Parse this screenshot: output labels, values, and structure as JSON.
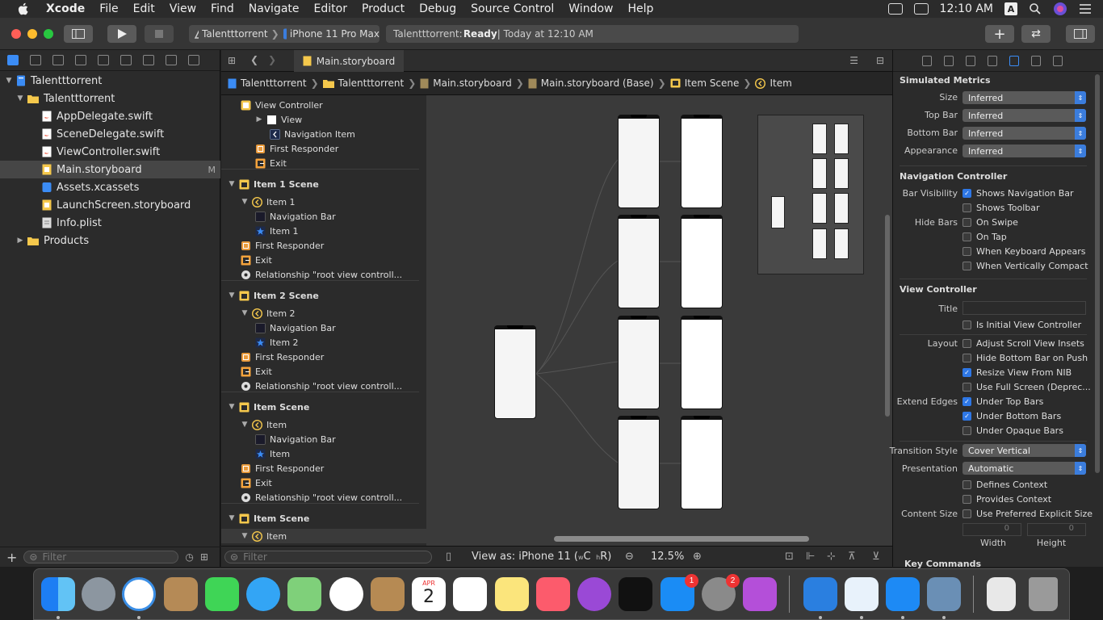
{
  "menubar": {
    "items": [
      "Xcode",
      "File",
      "Edit",
      "View",
      "Find",
      "Navigate",
      "Editor",
      "Product",
      "Debug",
      "Source Control",
      "Window",
      "Help"
    ],
    "clock": "12:10 AM",
    "input_source": "A"
  },
  "toolbar": {
    "scheme": "Talentttorrent",
    "device": "iPhone 11 Pro Max",
    "status_project": "Talentttorrent: ",
    "status_state": "Ready",
    "status_time": " | Today at 12:10 AM"
  },
  "navigator": {
    "items": [
      {
        "label": "Talentttorrent",
        "icon": "project-icon"
      },
      {
        "label": "Talentttorrent",
        "icon": "folder-icon"
      },
      {
        "label": "AppDelegate.swift",
        "icon": "swift-file-icon"
      },
      {
        "label": "SceneDelegate.swift",
        "icon": "swift-file-icon"
      },
      {
        "label": "ViewController.swift",
        "icon": "swift-file-icon"
      },
      {
        "label": "Main.storyboard",
        "icon": "storyboard-file-icon",
        "badge": "M"
      },
      {
        "label": "Assets.xcassets",
        "icon": "assets-icon"
      },
      {
        "label": "LaunchScreen.storyboard",
        "icon": "storyboard-file-icon"
      },
      {
        "label": "Info.plist",
        "icon": "plist-file-icon"
      },
      {
        "label": "Products",
        "icon": "folder-icon"
      }
    ],
    "filter_placeholder": "Filter"
  },
  "editor": {
    "tab": "Main.storyboard",
    "breadcrumb": [
      "Talentttorrent",
      "Talentttorrent",
      "Main.storyboard",
      "Main.storyboard (Base)",
      "Item Scene",
      "Item"
    ]
  },
  "outline": {
    "rows": [
      {
        "label": "View Controller",
        "icon": "view-controller-icon"
      },
      {
        "label": "View",
        "icon": "view-icon"
      },
      {
        "label": "Navigation Item",
        "icon": "navigation-item-icon"
      },
      {
        "label": "First Responder",
        "icon": "first-responder-icon"
      },
      {
        "label": "Exit",
        "icon": "exit-icon"
      },
      {
        "label": "Item 1 Scene",
        "icon": "scene-icon"
      },
      {
        "label": "Item 1",
        "icon": "navigation-controller-icon"
      },
      {
        "label": "Navigation Bar",
        "icon": "navigation-bar-icon"
      },
      {
        "label": "Item 1",
        "icon": "tab-bar-item-icon"
      },
      {
        "label": "First Responder",
        "icon": "first-responder-icon"
      },
      {
        "label": "Exit",
        "icon": "exit-icon"
      },
      {
        "label": "Relationship \"root view controll...",
        "icon": "relationship-icon"
      },
      {
        "label": "Item 2 Scene",
        "icon": "scene-icon"
      },
      {
        "label": "Item 2",
        "icon": "navigation-controller-icon"
      },
      {
        "label": "Navigation Bar",
        "icon": "navigation-bar-icon"
      },
      {
        "label": "Item 2",
        "icon": "tab-bar-item-icon"
      },
      {
        "label": "First Responder",
        "icon": "first-responder-icon"
      },
      {
        "label": "Exit",
        "icon": "exit-icon"
      },
      {
        "label": "Relationship \"root view controll...",
        "icon": "relationship-icon"
      },
      {
        "label": "Item Scene",
        "icon": "scene-icon"
      },
      {
        "label": "Item",
        "icon": "navigation-controller-icon"
      },
      {
        "label": "Navigation Bar",
        "icon": "navigation-bar-icon"
      },
      {
        "label": "Item",
        "icon": "tab-bar-item-icon"
      },
      {
        "label": "First Responder",
        "icon": "first-responder-icon"
      },
      {
        "label": "Exit",
        "icon": "exit-icon"
      },
      {
        "label": "Relationship \"root view controll...",
        "icon": "relationship-icon"
      },
      {
        "label": "Item Scene",
        "icon": "scene-icon"
      },
      {
        "label": "Item",
        "icon": "navigation-controller-icon"
      }
    ],
    "filter_placeholder": "Filter"
  },
  "canvas_bar": {
    "view_as_prefix": "View as: iPhone 11 (",
    "size_w": "w",
    "size_c": "C",
    "size_h": "h",
    "size_r": "R",
    "view_as_suffix": ")",
    "zoom": "12.5%"
  },
  "inspector": {
    "simulated_metrics": "Simulated Metrics",
    "size_label": "Size",
    "size_value": "Inferred",
    "topbar_label": "Top Bar",
    "topbar_value": "Inferred",
    "bottombar_label": "Bottom Bar",
    "bottombar_value": "Inferred",
    "appearance_label": "Appearance",
    "appearance_value": "Inferred",
    "nav_controller": "Navigation Controller",
    "bar_visibility_label": "Bar Visibility",
    "shows_nav_bar": "Shows Navigation Bar",
    "shows_toolbar": "Shows Toolbar",
    "hide_bars_label": "Hide Bars",
    "on_swipe": "On Swipe",
    "on_tap": "On Tap",
    "when_keyboard": "When Keyboard Appears",
    "when_compact": "When Vertically Compact",
    "view_controller": "View Controller",
    "title_label": "Title",
    "is_initial": "Is Initial View Controller",
    "layout_label": "Layout",
    "adjust_scroll": "Adjust Scroll View Insets",
    "hide_bottom": "Hide Bottom Bar on Push",
    "resize_nib": "Resize View From NIB",
    "full_screen": "Use Full Screen (Deprec...",
    "extend_edges_label": "Extend Edges",
    "under_top": "Under Top Bars",
    "under_bottom": "Under Bottom Bars",
    "under_opaque": "Under Opaque Bars",
    "transition_label": "Transition Style",
    "transition_value": "Cover Vertical",
    "presentation_label": "Presentation",
    "presentation_value": "Automatic",
    "defines_context": "Defines Context",
    "provides_context": "Provides Context",
    "content_size_label": "Content Size",
    "use_preferred": "Use Preferred Explicit Size",
    "width_value": "0",
    "height_value": "0",
    "width_label": "Width",
    "height_label": "Height",
    "key_commands": "Key Commands"
  },
  "dock": {
    "calendar_month": "APR",
    "calendar_day": "2",
    "appstore_badge": "1",
    "prefs_badge": "2"
  }
}
